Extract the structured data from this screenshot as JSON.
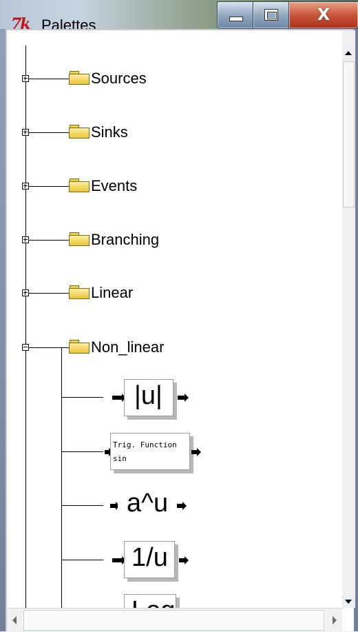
{
  "window": {
    "app_icon_text": "7k",
    "title": "Palettes",
    "close_glyph": "X"
  },
  "tree": {
    "nodes": [
      {
        "label": "Sources",
        "expanded": false
      },
      {
        "label": "Sinks",
        "expanded": false
      },
      {
        "label": "Events",
        "expanded": false
      },
      {
        "label": "Branching",
        "expanded": false
      },
      {
        "label": "Linear",
        "expanded": false
      },
      {
        "label": "Non_linear",
        "expanded": true
      }
    ],
    "non_linear_blocks": [
      {
        "label": "|u|"
      },
      {
        "title": "Trig. Function",
        "subtitle": "sin"
      },
      {
        "label": "a^u"
      },
      {
        "label": "1/u"
      },
      {
        "label": "Log"
      }
    ]
  }
}
